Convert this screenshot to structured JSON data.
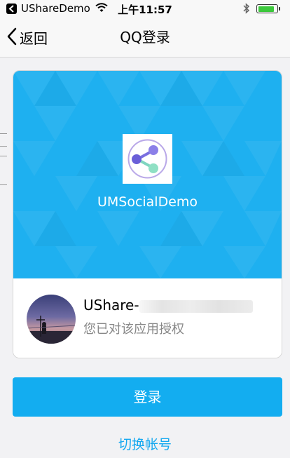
{
  "status_bar": {
    "app_name": "UShareDemo",
    "time": "上午11:57",
    "battery_level": 0.9,
    "battery_color": "#3cc83c"
  },
  "nav": {
    "back_label": "返回",
    "title": "QQ登录"
  },
  "card": {
    "app_name": "UMSocialDemo",
    "banner_color": "#1eb0f0",
    "user_name": "UShare-",
    "auth_text": "您已对该应用授权"
  },
  "actions": {
    "login_label": "登录",
    "login_color": "#13adf0",
    "switch_account_label": "切换帐号"
  }
}
